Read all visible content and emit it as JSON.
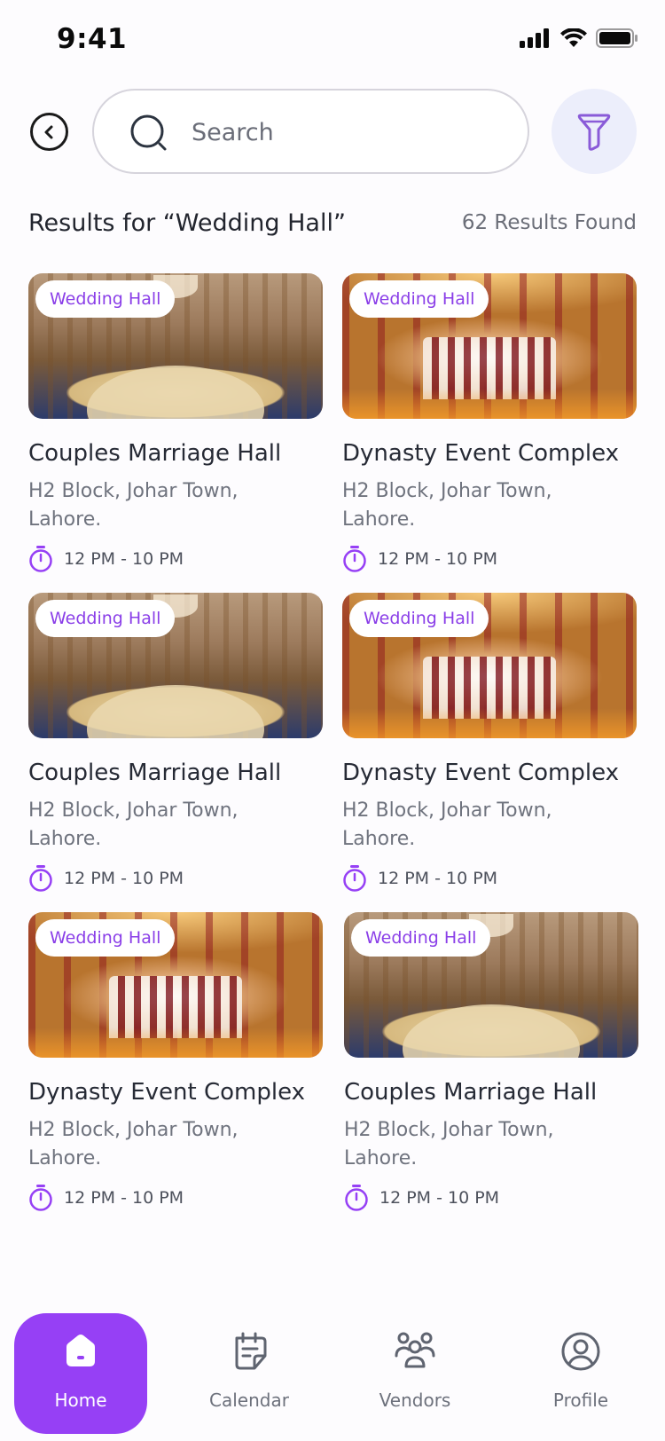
{
  "status_bar": {
    "time": "9:41"
  },
  "search": {
    "placeholder": "Search"
  },
  "results": {
    "title": "Results for “Wedding Hall”",
    "count": "62 Results Found"
  },
  "cards": [
    {
      "tag": "Wedding Hall",
      "name": "Couples Marriage Hall",
      "address": "H2 Block, Johar Town, Lahore.",
      "hours": "12 PM - 10 PM",
      "image": "banquet-hall-round-tables"
    },
    {
      "tag": "Wedding Hall",
      "name": "Dynasty Event Complex",
      "address": "H2 Block, Johar Town, Lahore.",
      "hours": "12 PM - 10 PM",
      "image": "decorated-wedding-stage"
    },
    {
      "tag": "Wedding Hall",
      "name": "Couples Marriage Hall",
      "address": "H2 Block, Johar Town, Lahore.",
      "hours": "12 PM - 10 PM",
      "image": "banquet-hall-round-tables"
    },
    {
      "tag": "Wedding Hall",
      "name": "Dynasty Event Complex",
      "address": "H2 Block, Johar Town, Lahore.",
      "hours": "12 PM - 10 PM",
      "image": "decorated-wedding-stage"
    },
    {
      "tag": "Wedding Hall",
      "name": "Dynasty Event Complex",
      "address": "H2 Block, Johar Town, Lahore.",
      "hours": "12 PM - 10 PM",
      "image": "decorated-wedding-stage"
    },
    {
      "tag": "Wedding Hall",
      "name": "Couples Marriage Hall",
      "address": "H2 Block, Johar Town, Lahore.",
      "hours": "12 PM - 10 PM",
      "image": "banquet-hall-round-tables"
    }
  ],
  "nav": {
    "items": [
      {
        "label": "Home",
        "icon": "home-icon",
        "active": true
      },
      {
        "label": "Calendar",
        "icon": "calendar-icon",
        "active": false
      },
      {
        "label": "Vendors",
        "icon": "vendors-icon",
        "active": false
      },
      {
        "label": "Profile",
        "icon": "profile-icon",
        "active": false
      }
    ]
  },
  "colors": {
    "accent": "#9640f5",
    "tag_text": "#8a3ee8",
    "filter_bg": "#eceefb",
    "text_primary": "#262a35",
    "text_secondary": "#6f737e"
  }
}
